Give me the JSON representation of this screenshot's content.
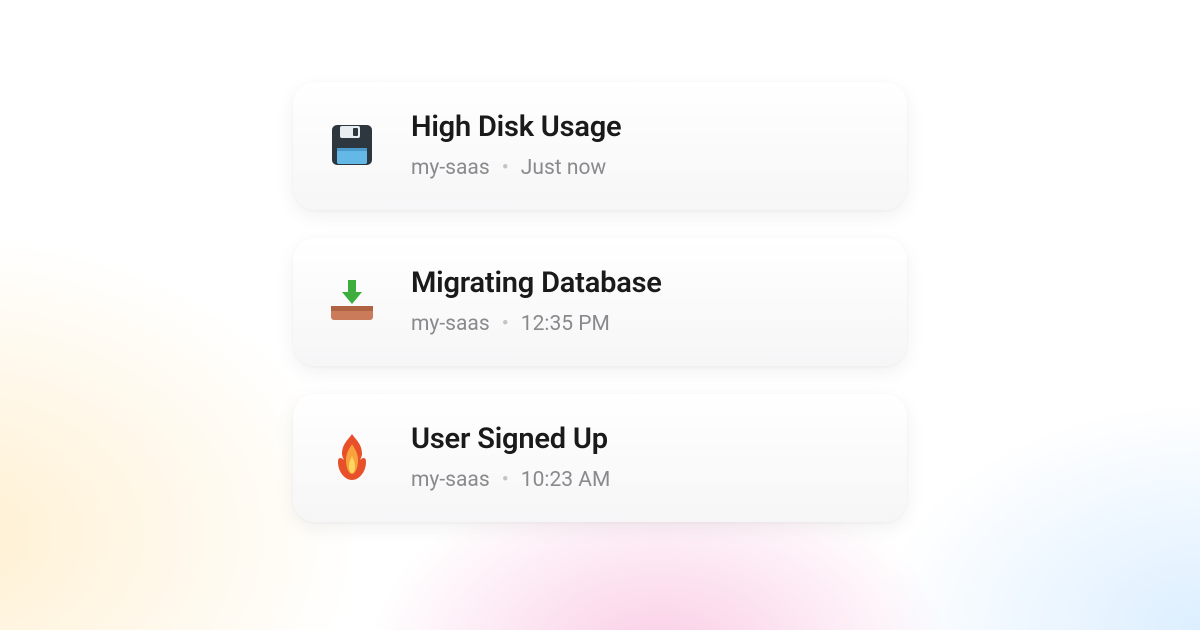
{
  "notifications": [
    {
      "icon": "floppy-disk-icon",
      "title": "High Disk Usage",
      "project": "my-saas",
      "time": "Just now"
    },
    {
      "icon": "inbox-download-icon",
      "title": "Migrating Database",
      "project": "my-saas",
      "time": "12:35 PM"
    },
    {
      "icon": "fire-icon",
      "title": "User Signed Up",
      "project": "my-saas",
      "time": "10:23 AM"
    }
  ]
}
